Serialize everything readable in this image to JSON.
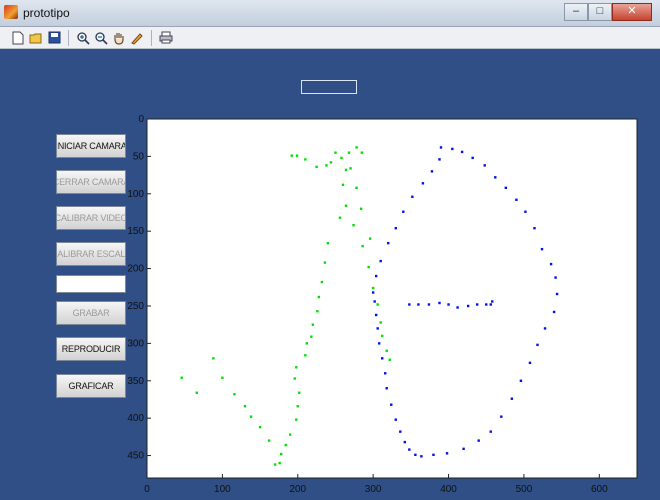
{
  "window": {
    "title": "prototipo",
    "controls": {
      "minimize": "–",
      "maximize": "□",
      "close": "✕"
    }
  },
  "toolbar": {
    "icons": [
      "new-file-icon",
      "open-folder-icon",
      "save-icon",
      "zoom-in-icon",
      "zoom-out-icon",
      "pan-hand-icon",
      "data-cursor-icon",
      "print-icon"
    ]
  },
  "controls": {
    "top_edit_value": "",
    "iniciar": "INICIAR CAMARA",
    "cerrar": "CERRAR CAMARA",
    "calibrar_video": "CALIBRAR VIDEO",
    "calibrar_escala": "CALIBRAR ESCALA",
    "text_value": "",
    "grabar": "GRABAR",
    "reproducir": "REPRODUCIR",
    "graficar": "GRAFICAR"
  },
  "colors": {
    "figure_bg": "#2f4f86",
    "axes_bg": "#ffffff",
    "series_green": "#00e000",
    "series_blue": "#0010e8"
  },
  "chart_data": {
    "type": "scatter",
    "xlim": [
      0,
      650
    ],
    "ylim": [
      0,
      480
    ],
    "y_reversed": true,
    "x_ticks": [
      0,
      100,
      200,
      300,
      400,
      500,
      600
    ],
    "x_tick_labels": [
      "0",
      "100",
      "200",
      "300",
      "400",
      "500",
      "600"
    ],
    "y_ticks": [
      0,
      50,
      100,
      150,
      200,
      250,
      300,
      350,
      400,
      450
    ],
    "y_tick_labels": [
      "0",
      "50",
      "100",
      "150",
      "200",
      "250",
      "300",
      "350",
      "400",
      "450"
    ],
    "grid": false,
    "series": [
      {
        "color": "#00e000",
        "points": [
          [
            192,
            49
          ],
          [
            199,
            49
          ],
          [
            210,
            54
          ],
          [
            225,
            64
          ],
          [
            238,
            62
          ],
          [
            244,
            58
          ],
          [
            250,
            45
          ],
          [
            258,
            52
          ],
          [
            268,
            45
          ],
          [
            278,
            38
          ],
          [
            285,
            45
          ],
          [
            264,
            68
          ],
          [
            260,
            88
          ],
          [
            264,
            116
          ],
          [
            256,
            132
          ],
          [
            240,
            166
          ],
          [
            236,
            192
          ],
          [
            232,
            218
          ],
          [
            228,
            238
          ],
          [
            226,
            257
          ],
          [
            220,
            275
          ],
          [
            218,
            291
          ],
          [
            212,
            300
          ],
          [
            210,
            316
          ],
          [
            198,
            332
          ],
          [
            196,
            347
          ],
          [
            202,
            366
          ],
          [
            200,
            384
          ],
          [
            198,
            402
          ],
          [
            190,
            422
          ],
          [
            184,
            436
          ],
          [
            178,
            448
          ],
          [
            176,
            460
          ],
          [
            170,
            462
          ],
          [
            162,
            430
          ],
          [
            150,
            412
          ],
          [
            138,
            398
          ],
          [
            130,
            384
          ],
          [
            116,
            368
          ],
          [
            100,
            346
          ],
          [
            88,
            320
          ],
          [
            66,
            366
          ],
          [
            46,
            346
          ],
          [
            274,
            142
          ],
          [
            286,
            170
          ],
          [
            294,
            198
          ],
          [
            300,
            226
          ],
          [
            306,
            248
          ],
          [
            310,
            272
          ],
          [
            312,
            290
          ],
          [
            318,
            310
          ],
          [
            322,
            322
          ],
          [
            296,
            160
          ],
          [
            284,
            120
          ],
          [
            278,
            92
          ],
          [
            270,
            66
          ]
        ]
      },
      {
        "color": "#0010e8",
        "points": [
          [
            390,
            38
          ],
          [
            405,
            40
          ],
          [
            418,
            44
          ],
          [
            432,
            52
          ],
          [
            448,
            62
          ],
          [
            462,
            78
          ],
          [
            476,
            92
          ],
          [
            490,
            108
          ],
          [
            502,
            124
          ],
          [
            514,
            146
          ],
          [
            524,
            174
          ],
          [
            536,
            194
          ],
          [
            542,
            212
          ],
          [
            544,
            234
          ],
          [
            540,
            258
          ],
          [
            528,
            280
          ],
          [
            518,
            302
          ],
          [
            508,
            326
          ],
          [
            496,
            350
          ],
          [
            484,
            374
          ],
          [
            470,
            398
          ],
          [
            456,
            418
          ],
          [
            440,
            430
          ],
          [
            420,
            441
          ],
          [
            398,
            447
          ],
          [
            380,
            449
          ],
          [
            364,
            451
          ],
          [
            356,
            449
          ],
          [
            348,
            442
          ],
          [
            342,
            432
          ],
          [
            336,
            418
          ],
          [
            330,
            402
          ],
          [
            324,
            382
          ],
          [
            318,
            360
          ],
          [
            316,
            340
          ],
          [
            312,
            320
          ],
          [
            308,
            300
          ],
          [
            306,
            280
          ],
          [
            304,
            262
          ],
          [
            302,
            244
          ],
          [
            300,
            232
          ],
          [
            304,
            210
          ],
          [
            310,
            190
          ],
          [
            320,
            166
          ],
          [
            330,
            146
          ],
          [
            340,
            124
          ],
          [
            352,
            104
          ],
          [
            366,
            86
          ],
          [
            378,
            70
          ],
          [
            388,
            54
          ],
          [
            348,
            248
          ],
          [
            360,
            248
          ],
          [
            374,
            248
          ],
          [
            388,
            246
          ],
          [
            400,
            248
          ],
          [
            412,
            252
          ],
          [
            426,
            250
          ],
          [
            438,
            248
          ],
          [
            450,
            248
          ],
          [
            456,
            248
          ],
          [
            458,
            244
          ]
        ]
      }
    ]
  }
}
